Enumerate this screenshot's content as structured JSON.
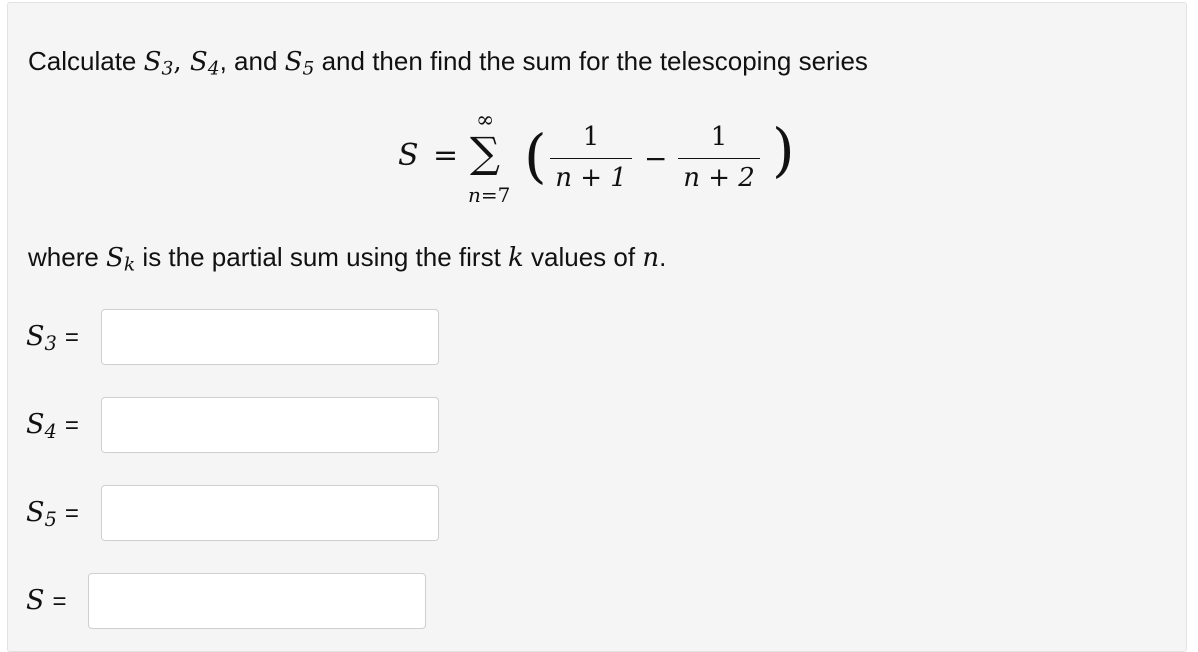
{
  "prompt": {
    "text_start": "Calculate ",
    "s3": "S",
    "s3_sub": "3",
    "comma1": ", ",
    "s4": "S",
    "s4_sub": "4",
    "comma2": ", and ",
    "s5": "S",
    "s5_sub": "5",
    "text_end": " and then find the sum for the telescoping series"
  },
  "formula": {
    "lhs": "S",
    "equals": "=",
    "sigma": "∑",
    "upper_limit": "∞",
    "lower_var": "n",
    "lower_eq": "=7",
    "frac1_num": "1",
    "frac1_den": "n + 1",
    "minus": "−",
    "frac2_num": "1",
    "frac2_den": "n + 2",
    "lparen": "(",
    "rparen": ")"
  },
  "where": {
    "text_start": "where ",
    "sk": "S",
    "sk_sub": "k",
    "text_mid": " is the partial sum using the first ",
    "k": "k",
    "text_mid2": " values of ",
    "n": "n",
    "text_end": "."
  },
  "answers": [
    {
      "label": "S",
      "sub": "3",
      "eq": "=",
      "value": ""
    },
    {
      "label": "S",
      "sub": "4",
      "eq": "=",
      "value": ""
    },
    {
      "label": "S",
      "sub": "5",
      "eq": "=",
      "value": ""
    },
    {
      "label": "S",
      "sub": "",
      "eq": "=",
      "value": ""
    }
  ]
}
